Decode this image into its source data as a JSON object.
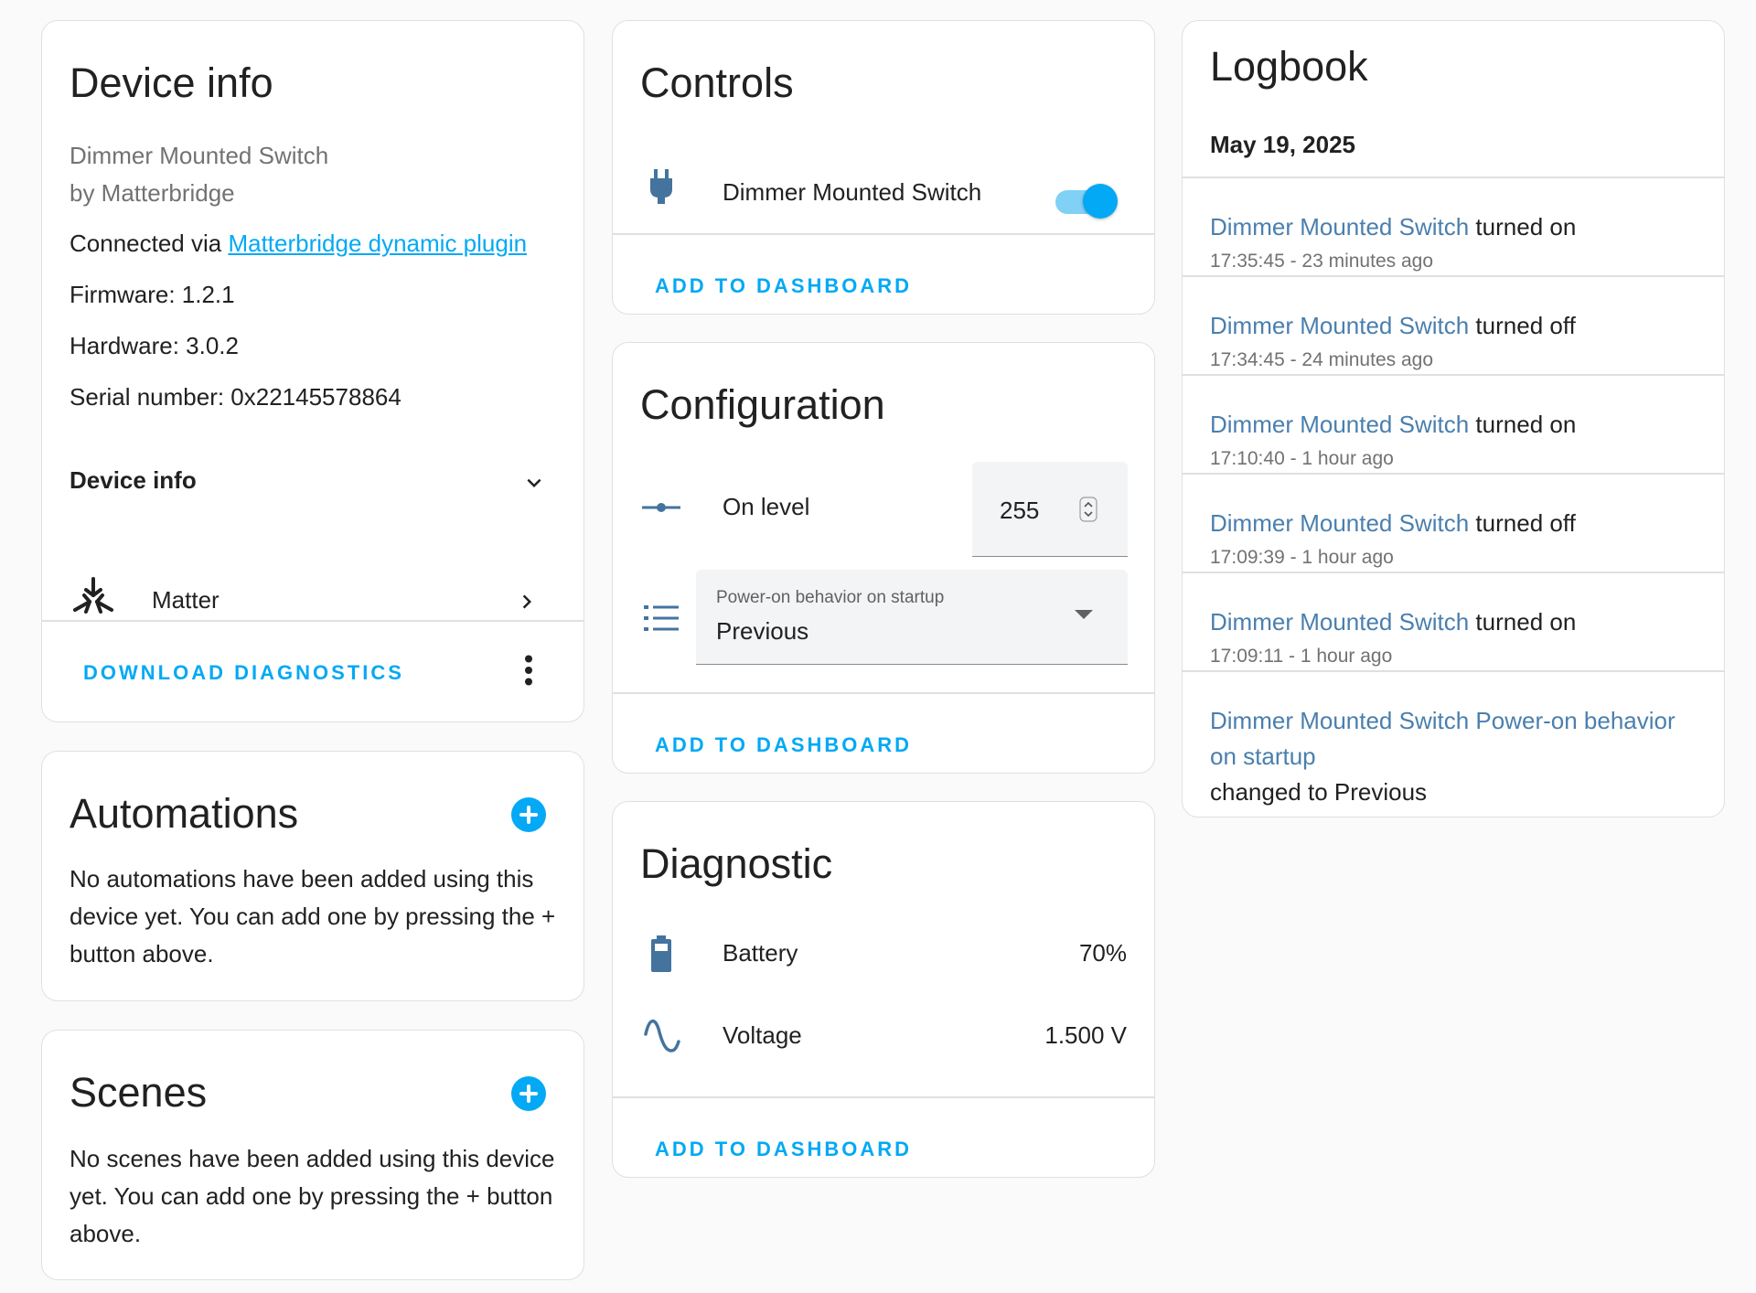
{
  "device_info": {
    "title": "Device info",
    "model": "Dimmer Mounted Switch",
    "manufacturer": "by Matterbridge",
    "connected_prefix": "Connected via ",
    "connected_link": "Matterbridge dynamic plugin",
    "firmware": "Firmware: 1.2.1",
    "hardware": "Hardware: 3.0.2",
    "serial": "Serial number: 0x22145578864",
    "expander_label": "Device info",
    "integration": "Matter",
    "download_label": "DOWNLOAD DIAGNOSTICS"
  },
  "automations": {
    "title": "Automations",
    "line1": "No automations have been added using this",
    "line2": "device yet. You can add one by pressing the +",
    "line3": "button above."
  },
  "scenes": {
    "title": "Scenes",
    "line1": "No scenes have been added using this device",
    "line2": "yet. You can add one by pressing the + button",
    "line3": "above."
  },
  "controls": {
    "title": "Controls",
    "entity": "Dimmer Mounted Switch",
    "switch_on": true,
    "add_label": "ADD TO DASHBOARD"
  },
  "configuration": {
    "title": "Configuration",
    "on_level_label": "On level",
    "on_level_value": "255",
    "select_label": "Power-on behavior on startup",
    "select_value": "Previous",
    "add_label": "ADD TO DASHBOARD"
  },
  "diagnostic": {
    "title": "Diagnostic",
    "battery_label": "Battery",
    "battery_value": "70%",
    "voltage_label": "Voltage",
    "voltage_value": "1.500 V",
    "add_label": "ADD TO DASHBOARD"
  },
  "logbook": {
    "title": "Logbook",
    "date": "May 19, 2025",
    "entries": [
      {
        "name": "Dimmer Mounted Switch",
        "action": " turned on",
        "time": "17:35:45 - 23 minutes ago"
      },
      {
        "name": "Dimmer Mounted Switch",
        "action": " turned off",
        "time": "17:34:45 - 24 minutes ago"
      },
      {
        "name": "Dimmer Mounted Switch",
        "action": " turned on",
        "time": "17:10:40 - 1 hour ago"
      },
      {
        "name": "Dimmer Mounted Switch",
        "action": " turned off",
        "time": "17:09:39 - 1 hour ago"
      },
      {
        "name": "Dimmer Mounted Switch",
        "action": " turned on",
        "time": "17:09:11 - 1 hour ago"
      }
    ],
    "last_entry": {
      "name_line1": "Dimmer Mounted Switch Power-on behavior",
      "name_line2": "on startup",
      "action": "changed to Previous"
    }
  },
  "colors": {
    "accent": "#03a9f4",
    "entity_link": "#4a7fae",
    "icon": "#44739e",
    "secondary_text": "#727272"
  }
}
